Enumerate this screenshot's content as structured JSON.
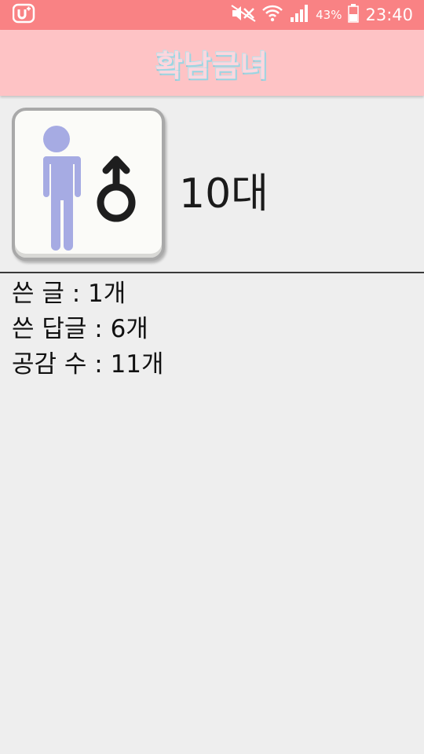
{
  "status_bar": {
    "carrier_icon": "u-plus-icon",
    "battery_percent": "43%",
    "time": "23:40"
  },
  "app_bar": {
    "title": "확남금녀"
  },
  "profile": {
    "avatar_icon": "male-person-icon",
    "age": "10대"
  },
  "stats": {
    "posts": "쓴 글 : 1개",
    "replies": "쓴 답글 : 6개",
    "likes": "공감 수 : 11개"
  },
  "colors": {
    "status_bar": "#f98284",
    "app_bar": "#fec3c5",
    "background": "#eeeeee",
    "person_figure": "#a6abe3"
  }
}
